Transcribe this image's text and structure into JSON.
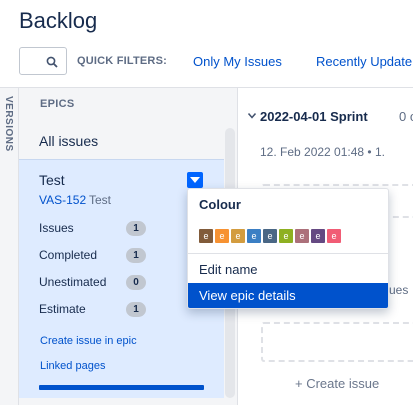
{
  "page": {
    "title": "Backlog"
  },
  "quick_filters": {
    "label": "QUICK FILTERS:",
    "items": [
      "Only My Issues",
      "Recently Update"
    ]
  },
  "versions_tab": {
    "label": "VERSIONS"
  },
  "epics": {
    "header": "EPICS",
    "all_issues": "All issues",
    "epic": {
      "name": "Test",
      "key": "VAS-152",
      "key_name": "Test",
      "stats": [
        {
          "label": "Issues",
          "value": "1"
        },
        {
          "label": "Completed",
          "value": "1"
        },
        {
          "label": "Unestimated",
          "value": "0"
        },
        {
          "label": "Estimate",
          "value": "1"
        }
      ],
      "create_issue": "Create issue in epic",
      "linked_pages": "Linked pages",
      "progress": 1.0
    }
  },
  "sprint": {
    "title": "2022-04-01 Sprint",
    "count_partial": "0 of",
    "meta": "12. Feb 2022 01:48 • 1.",
    "backlog_partial": "ues",
    "create_issue": "+  Create issue"
  },
  "epic_menu": {
    "colour_title": "Colour",
    "swatches": [
      {
        "letter": "e",
        "color": "#815b3a"
      },
      {
        "letter": "e",
        "color": "#f79232"
      },
      {
        "letter": "e",
        "color": "#d39c3f"
      },
      {
        "letter": "e",
        "color": "#3b7fc4"
      },
      {
        "letter": "e",
        "color": "#4a6785"
      },
      {
        "letter": "e",
        "color": "#8eb021"
      },
      {
        "letter": "e",
        "color": "#ac707a"
      },
      {
        "letter": "e",
        "color": "#654982"
      },
      {
        "letter": "e",
        "color": "#f15c75"
      }
    ],
    "items": [
      "Edit name",
      "View epic details"
    ],
    "active_index": 1
  },
  "colors": {
    "accent": "#0052cc",
    "epic_bg": "#deebff"
  }
}
